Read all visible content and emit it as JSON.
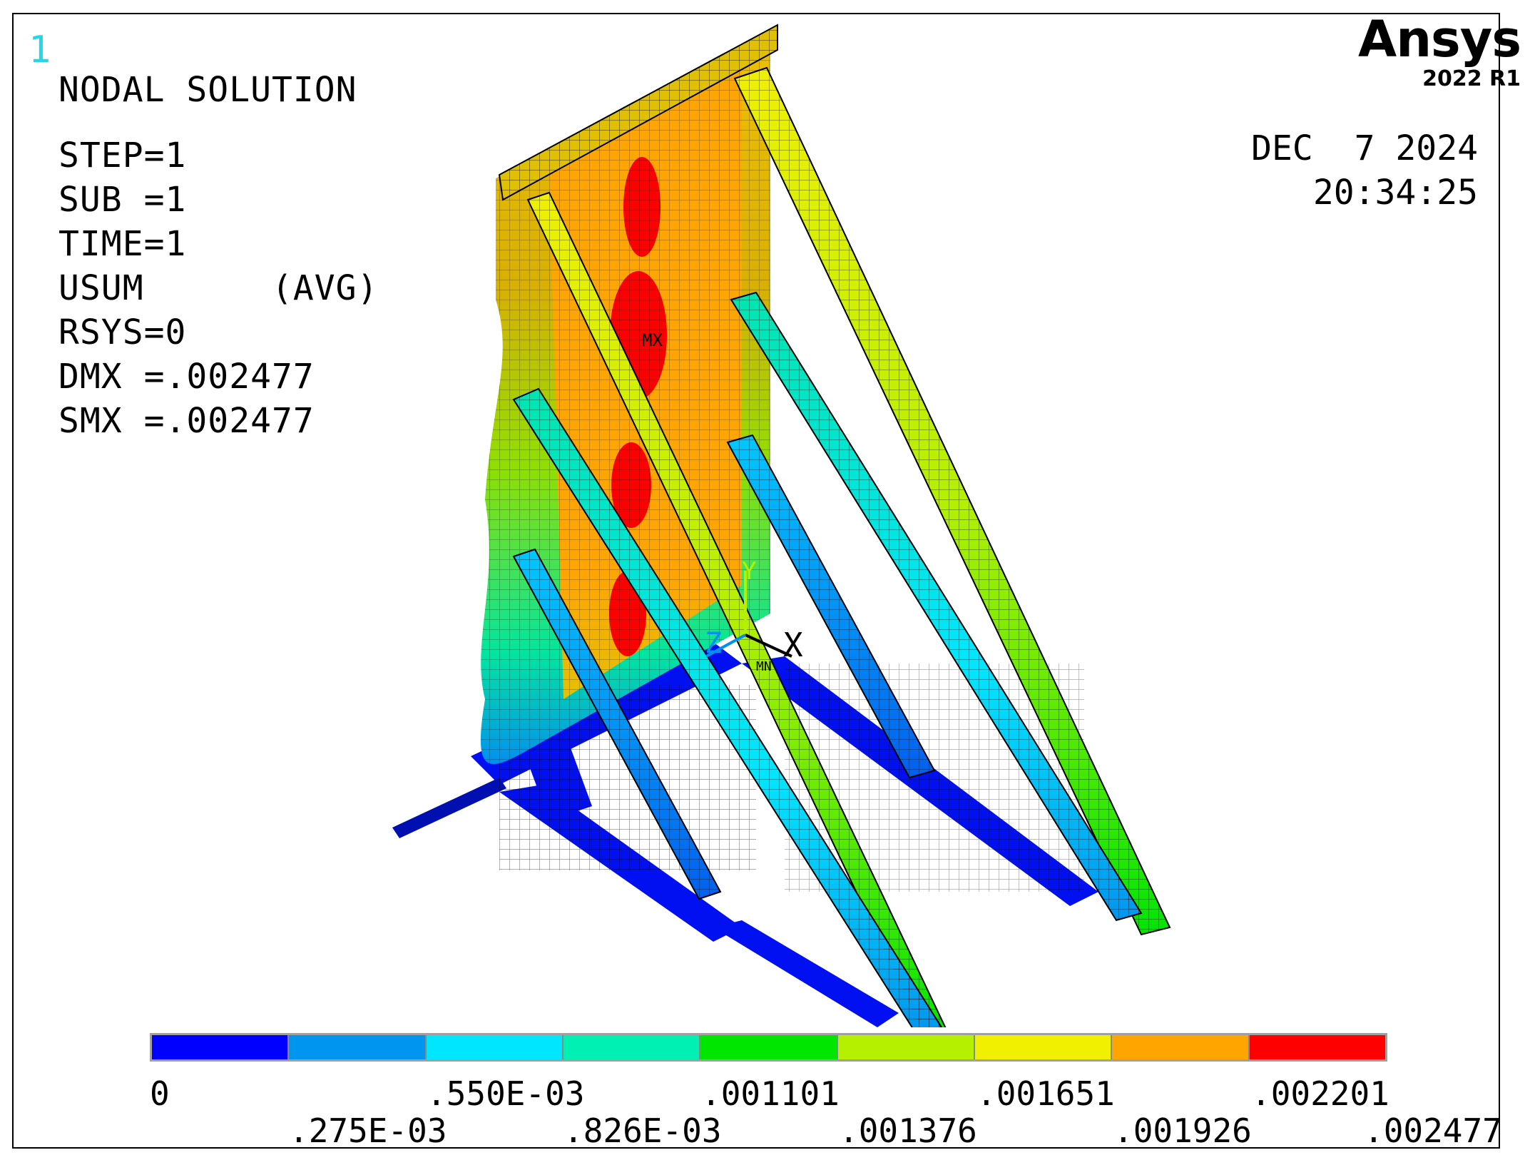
{
  "window_number": "1",
  "brand": {
    "name": "Ansys",
    "version": "2022 R1"
  },
  "info_lines": [
    "NODAL SOLUTION",
    "STEP=1",
    "SUB =1",
    "TIME=1",
    "USUM      (AVG)",
    "RSYS=0",
    "DMX =.002477",
    "SMX =.002477"
  ],
  "date": "DEC  7 2024",
  "time": "20:34:25",
  "axis_labels": {
    "x": "X",
    "y": "Y",
    "z": "Z",
    "mx": "MX",
    "mn": "MN"
  },
  "legend": {
    "colors": [
      "#0000ff",
      "#0096f0",
      "#00e6ff",
      "#00f0b4",
      "#00e600",
      "#b4f000",
      "#f0f000",
      "#ffa500",
      "#ff0000"
    ],
    "upper_labels": [
      "0",
      ".550E-03",
      ".001101",
      ".001651",
      ".002201"
    ],
    "lower_labels": [
      ".275E-03",
      ".826E-03",
      ".001376",
      ".001926",
      ".002477"
    ]
  }
}
